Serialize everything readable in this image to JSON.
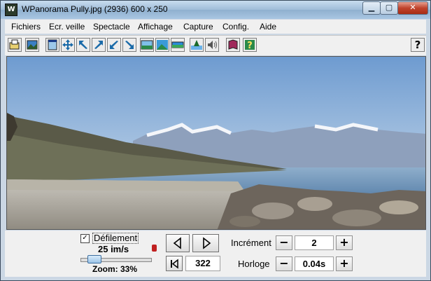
{
  "window": {
    "title": "WPanorama  Pully.jpg   (2936) 600 x 250"
  },
  "menu": [
    "Fichiers",
    "Ecr. veille",
    "Spectacle",
    "Affichage",
    "Capture",
    "Config.",
    "Aide"
  ],
  "toolbar": {
    "icons": [
      "open-file-icon",
      "image-icon",
      "window-icon",
      "move-icon",
      "arrow-up-left-icon",
      "arrow-up-right-icon",
      "arrow-down-left-icon",
      "arrow-down-right-icon",
      "landscape-frame-icon",
      "landscape-icon",
      "screen-icon",
      "tree-icon",
      "speaker-icon",
      "book-icon",
      "info-help-icon"
    ],
    "help_label": "?"
  },
  "controls": {
    "scroll_label": "Défilement",
    "scroll_checked": true,
    "speed": "25 im/s",
    "zoom": "Zoom: 33%",
    "zoom_fraction": 0.33,
    "position": "322",
    "increment_label": "Incrément",
    "increment_value": "2",
    "clock_label": "Horloge",
    "clock_value": "0.04s",
    "minus": "−",
    "plus": "+"
  }
}
